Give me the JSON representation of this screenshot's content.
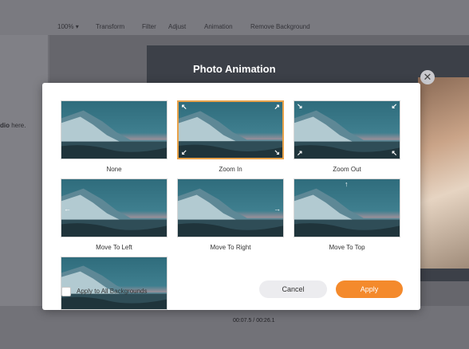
{
  "toolbar": {
    "zoom": "100%",
    "zoom_caret": "▾",
    "items": [
      "Transform",
      "Filter",
      "Adjust",
      "Animation",
      "Remove Background"
    ]
  },
  "left_panel": {
    "hint_bold": "dio",
    "hint_rest": " here."
  },
  "preview": {
    "title": "Photo Animation"
  },
  "timecode": "00:07.5 / 00:26.1",
  "modal": {
    "close_glyph": "✕",
    "options": [
      {
        "label": "None",
        "selected": false,
        "arrow_icons": []
      },
      {
        "label": "Zoom In",
        "selected": true,
        "arrow_icons": [
          "arrow-nw-icon",
          "arrow-ne-icon",
          "arrow-sw-icon",
          "arrow-se-icon"
        ]
      },
      {
        "label": "Zoom Out",
        "selected": false,
        "arrow_icons": [
          "arrow-se-icon",
          "arrow-sw-icon",
          "arrow-ne-icon",
          "arrow-nw-icon"
        ]
      },
      {
        "label": "Move To Left",
        "selected": false,
        "arrow_icons": [
          "arrow-left-icon"
        ]
      },
      {
        "label": "Move To Right",
        "selected": false,
        "arrow_icons": [
          "arrow-right-icon"
        ]
      },
      {
        "label": "Move To Top",
        "selected": false,
        "arrow_icons": [
          "arrow-up-icon"
        ]
      },
      {
        "label": "",
        "selected": false,
        "arrow_icons": []
      }
    ],
    "apply_all_label": "Apply to All Backgrounds",
    "apply_all_checked": false,
    "cancel_label": "Cancel",
    "apply_label": "Apply"
  },
  "colors": {
    "accent": "#f48a2c",
    "selected_border": "#e8a24a",
    "sky": "#3f7f8f",
    "water": "#2f4d57",
    "sunset": "#d89aa0"
  }
}
